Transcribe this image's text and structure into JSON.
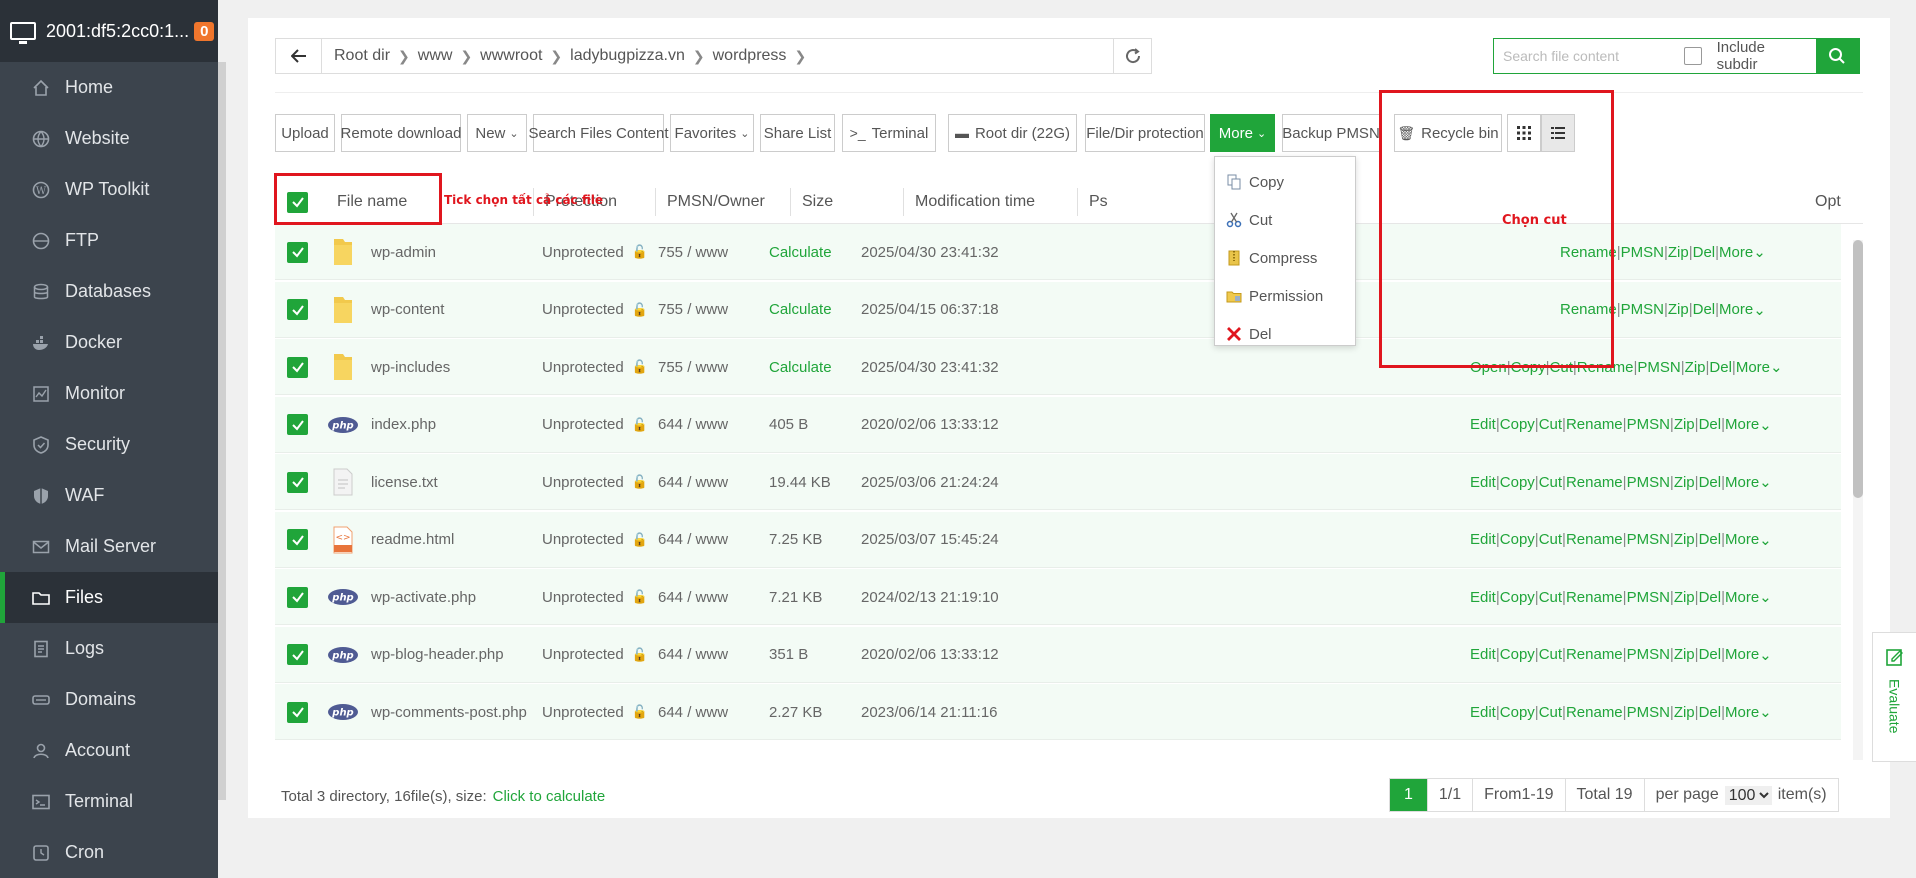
{
  "sidebar": {
    "server": "2001:df5:2cc0:1...",
    "badge": "0",
    "items": [
      {
        "label": "Home",
        "icon": "home-icon"
      },
      {
        "label": "Website",
        "icon": "globe-icon"
      },
      {
        "label": "WP Toolkit",
        "icon": "wordpress-icon"
      },
      {
        "label": "FTP",
        "icon": "ftp-icon"
      },
      {
        "label": "Databases",
        "icon": "database-icon"
      },
      {
        "label": "Docker",
        "icon": "docker-icon"
      },
      {
        "label": "Monitor",
        "icon": "monitor-icon"
      },
      {
        "label": "Security",
        "icon": "shield-icon"
      },
      {
        "label": "WAF",
        "icon": "waf-icon"
      },
      {
        "label": "Mail Server",
        "icon": "mail-icon"
      },
      {
        "label": "Files",
        "icon": "folder-icon"
      },
      {
        "label": "Logs",
        "icon": "logs-icon"
      },
      {
        "label": "Domains",
        "icon": "domains-icon"
      },
      {
        "label": "Account",
        "icon": "user-icon"
      },
      {
        "label": "Terminal",
        "icon": "terminal-icon"
      },
      {
        "label": "Cron",
        "icon": "clock-icon"
      }
    ],
    "active": "Files"
  },
  "path": {
    "crumbs": [
      "Root dir",
      "www",
      "wwwroot",
      "ladybugpizza.vn",
      "wordpress"
    ]
  },
  "search": {
    "placeholder": "Search file content",
    "include_subdir": "Include subdir"
  },
  "toolbar": {
    "upload": "Upload",
    "remote_download": "Remote download",
    "new": "New",
    "search_files_content": "Search Files Content",
    "favorites": "Favorites",
    "share_list": "Share List",
    "terminal": "Terminal",
    "root_dir": "Root dir (22G)",
    "file_dir_protection": "File/Dir protection",
    "more": "More",
    "backup_pmsn": "Backup PMSN",
    "recycle_bin": "Recycle bin"
  },
  "more_menu": [
    {
      "label": "Copy",
      "icon": "copy-icon"
    },
    {
      "label": "Cut",
      "icon": "scissors-icon"
    },
    {
      "label": "Compress",
      "icon": "compress-icon"
    },
    {
      "label": "Permission",
      "icon": "permission-icon"
    },
    {
      "label": "Del",
      "icon": "delete-icon"
    }
  ],
  "annotations": {
    "select_all": "Tick chọn tất cả các file",
    "choose_cut": "Chọn cut"
  },
  "table": {
    "headers": {
      "file_name": "File name",
      "protection": "Protection",
      "pmsn": "PMSN/Owner",
      "size": "Size",
      "mtime": "Modification time",
      "ps": "Ps",
      "opt": "Opt"
    },
    "rows": [
      {
        "name": "wp-admin",
        "type": "folder",
        "protection": "Unprotected",
        "pmsn": "755 / www",
        "size": "Calculate",
        "mtime": "2025/04/30 23:41:32"
      },
      {
        "name": "wp-content",
        "type": "folder",
        "protection": "Unprotected",
        "pmsn": "755 / www",
        "size": "Calculate",
        "mtime": "2025/04/15 06:37:18"
      },
      {
        "name": "wp-includes",
        "type": "folder",
        "protection": "Unprotected",
        "pmsn": "755 / www",
        "size": "Calculate",
        "mtime": "2025/04/30 23:41:32"
      },
      {
        "name": "index.php",
        "type": "php",
        "protection": "Unprotected",
        "pmsn": "644 / www",
        "size": "405 B",
        "mtime": "2020/02/06 13:33:12"
      },
      {
        "name": "license.txt",
        "type": "txt",
        "protection": "Unprotected",
        "pmsn": "644 / www",
        "size": "19.44 KB",
        "mtime": "2025/03/06 21:24:24"
      },
      {
        "name": "readme.html",
        "type": "html",
        "protection": "Unprotected",
        "pmsn": "644 / www",
        "size": "7.25 KB",
        "mtime": "2025/03/07 15:45:24"
      },
      {
        "name": "wp-activate.php",
        "type": "php",
        "protection": "Unprotected",
        "pmsn": "644 / www",
        "size": "7.21 KB",
        "mtime": "2024/02/13 21:19:10"
      },
      {
        "name": "wp-blog-header.php",
        "type": "php",
        "protection": "Unprotected",
        "pmsn": "644 / www",
        "size": "351 B",
        "mtime": "2020/02/06 13:33:12"
      },
      {
        "name": "wp-comments-post.php",
        "type": "php",
        "protection": "Unprotected",
        "pmsn": "644 / www",
        "size": "2.27 KB",
        "mtime": "2023/06/14 21:11:16"
      }
    ],
    "folder_ops_visible": [
      "Rename",
      "PMSN",
      "Zip",
      "Del",
      "More"
    ],
    "folder_ops_row3": [
      "Open",
      "Copy",
      "Cut",
      "Rename",
      "PMSN",
      "Zip",
      "Del",
      "More"
    ],
    "file_ops": [
      "Edit",
      "Copy",
      "Cut",
      "Rename",
      "PMSN",
      "Zip",
      "Del",
      "More"
    ]
  },
  "footer": {
    "summary": "Total 3 directory, 16file(s), size:",
    "calc_link": "Click to calculate",
    "page_current": "1",
    "page_of": "1/1",
    "range": "From1-19",
    "total": "Total 19",
    "per_page_label": "per page",
    "per_page_value": "100",
    "items_label": "item(s)"
  },
  "evaluate": "Evaluate",
  "colors": {
    "accent": "#20a53a",
    "sidebar": "#3c444d",
    "highlight": "#e0161e"
  }
}
